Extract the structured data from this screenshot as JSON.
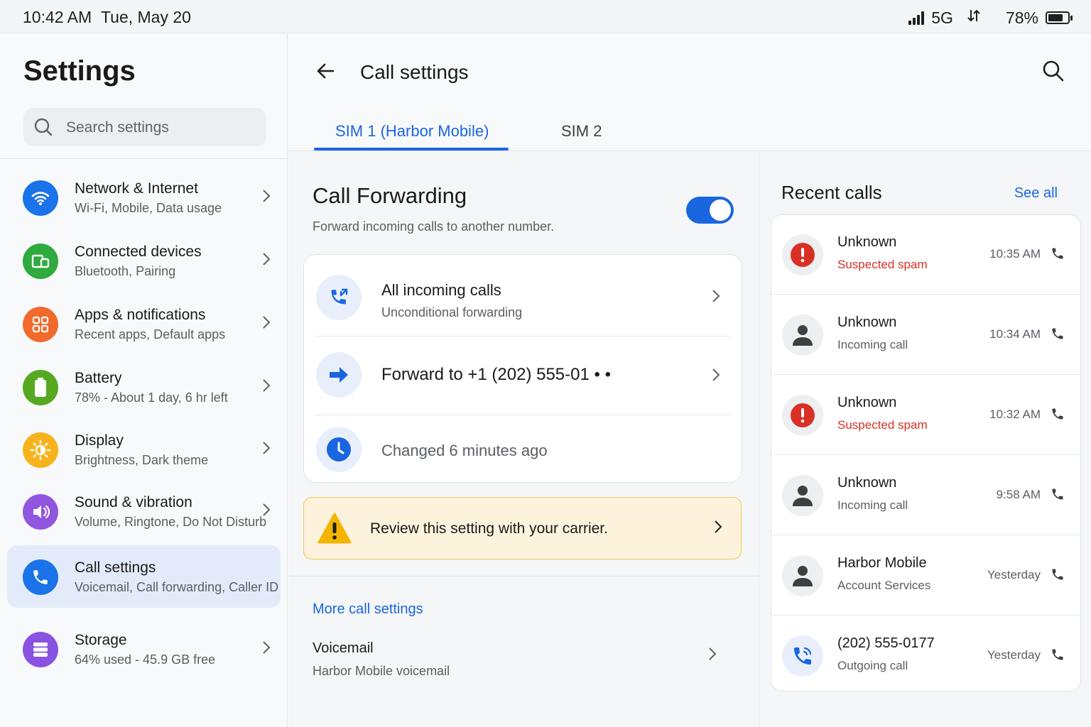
{
  "status_bar": {
    "time": "10:42 AM",
    "date": "Tue, May 20",
    "network": "5G",
    "battery": "78%",
    "battery_level": 0.78
  },
  "sidebar": {
    "title": "Settings",
    "search_placeholder": "Search settings",
    "items": [
      {
        "label": "Network & Internet",
        "subtitle": "Wi-Fi, Mobile, Data usage",
        "icon": "wifi-icon",
        "color": "#1a73e8"
      },
      {
        "label": "Connected devices",
        "subtitle": "Bluetooth, Pairing",
        "icon": "devices-icon",
        "color": "#2eaa3f"
      },
      {
        "label": "Apps & notifications",
        "subtitle": "Recent apps, Default apps",
        "icon": "apps-icon",
        "color": "#f26a2b"
      },
      {
        "label": "Battery",
        "subtitle": "78% - About 1 day, 6 hr left",
        "icon": "battery-icon",
        "color": "#56a820"
      },
      {
        "label": "Display",
        "subtitle": "Brightness, Dark theme",
        "icon": "brightness-icon",
        "color": "#f6b31b"
      },
      {
        "label": "Sound & vibration",
        "subtitle": "Volume, Ringtone, Do Not Disturb",
        "icon": "speaker-icon",
        "color": "#9155e0"
      },
      {
        "label": "Call settings",
        "subtitle": "Voicemail, Call forwarding, Caller ID",
        "icon": "phone-icon",
        "color": "#1a73e8",
        "active": true
      },
      {
        "label": "Storage",
        "subtitle": "64% used - 45.9 GB free",
        "icon": "storage-icon",
        "color": "#8a52e0"
      }
    ]
  },
  "header": {
    "title": "Call settings",
    "tabs": [
      "SIM 1 (Harbor Mobile)",
      "SIM 2"
    ],
    "active_tab": 0
  },
  "call_forwarding": {
    "title": "Call Forwarding",
    "description": "Forward incoming calls to another number.",
    "enabled": true,
    "rows": [
      {
        "label": "All incoming calls",
        "subtitle": "Unconditional forwarding",
        "icon": "call-forward-icon"
      },
      {
        "label": "Forward to +1 (202) 555-01 • •",
        "icon": "arrow-right-icon"
      },
      {
        "label": "Changed 6 minutes ago",
        "icon": "clock-icon"
      }
    ],
    "warning": "Review this setting with your carrier."
  },
  "more": {
    "link": "More call settings",
    "voicemail_label": "Voicemail",
    "voicemail_subtitle": "Harbor Mobile voicemail"
  },
  "recent_calls": {
    "title": "Recent calls",
    "see_all": "See all",
    "calls": [
      {
        "name": "Unknown",
        "subtitle": "Suspected spam",
        "time": "10:35 AM",
        "type": "spam"
      },
      {
        "name": "Unknown",
        "subtitle": "Incoming call",
        "time": "10:34 AM",
        "type": "person"
      },
      {
        "name": "Unknown",
        "subtitle": "Suspected spam",
        "time": "10:32 AM",
        "type": "spam"
      },
      {
        "name": "Unknown",
        "subtitle": "Incoming call",
        "time": "9:58 AM",
        "type": "person"
      },
      {
        "name": "Harbor Mobile",
        "subtitle": "Account Services",
        "time": "Yesterday",
        "type": "person"
      },
      {
        "name": "(202) 555-0177",
        "subtitle": "Outgoing call",
        "time": "Yesterday",
        "type": "outgoing"
      }
    ]
  },
  "colors": {
    "accent": "#1a66e0",
    "spam": "#d93025",
    "warning_bg": "#fdf3dc",
    "warning_border": "#f0c85a"
  }
}
